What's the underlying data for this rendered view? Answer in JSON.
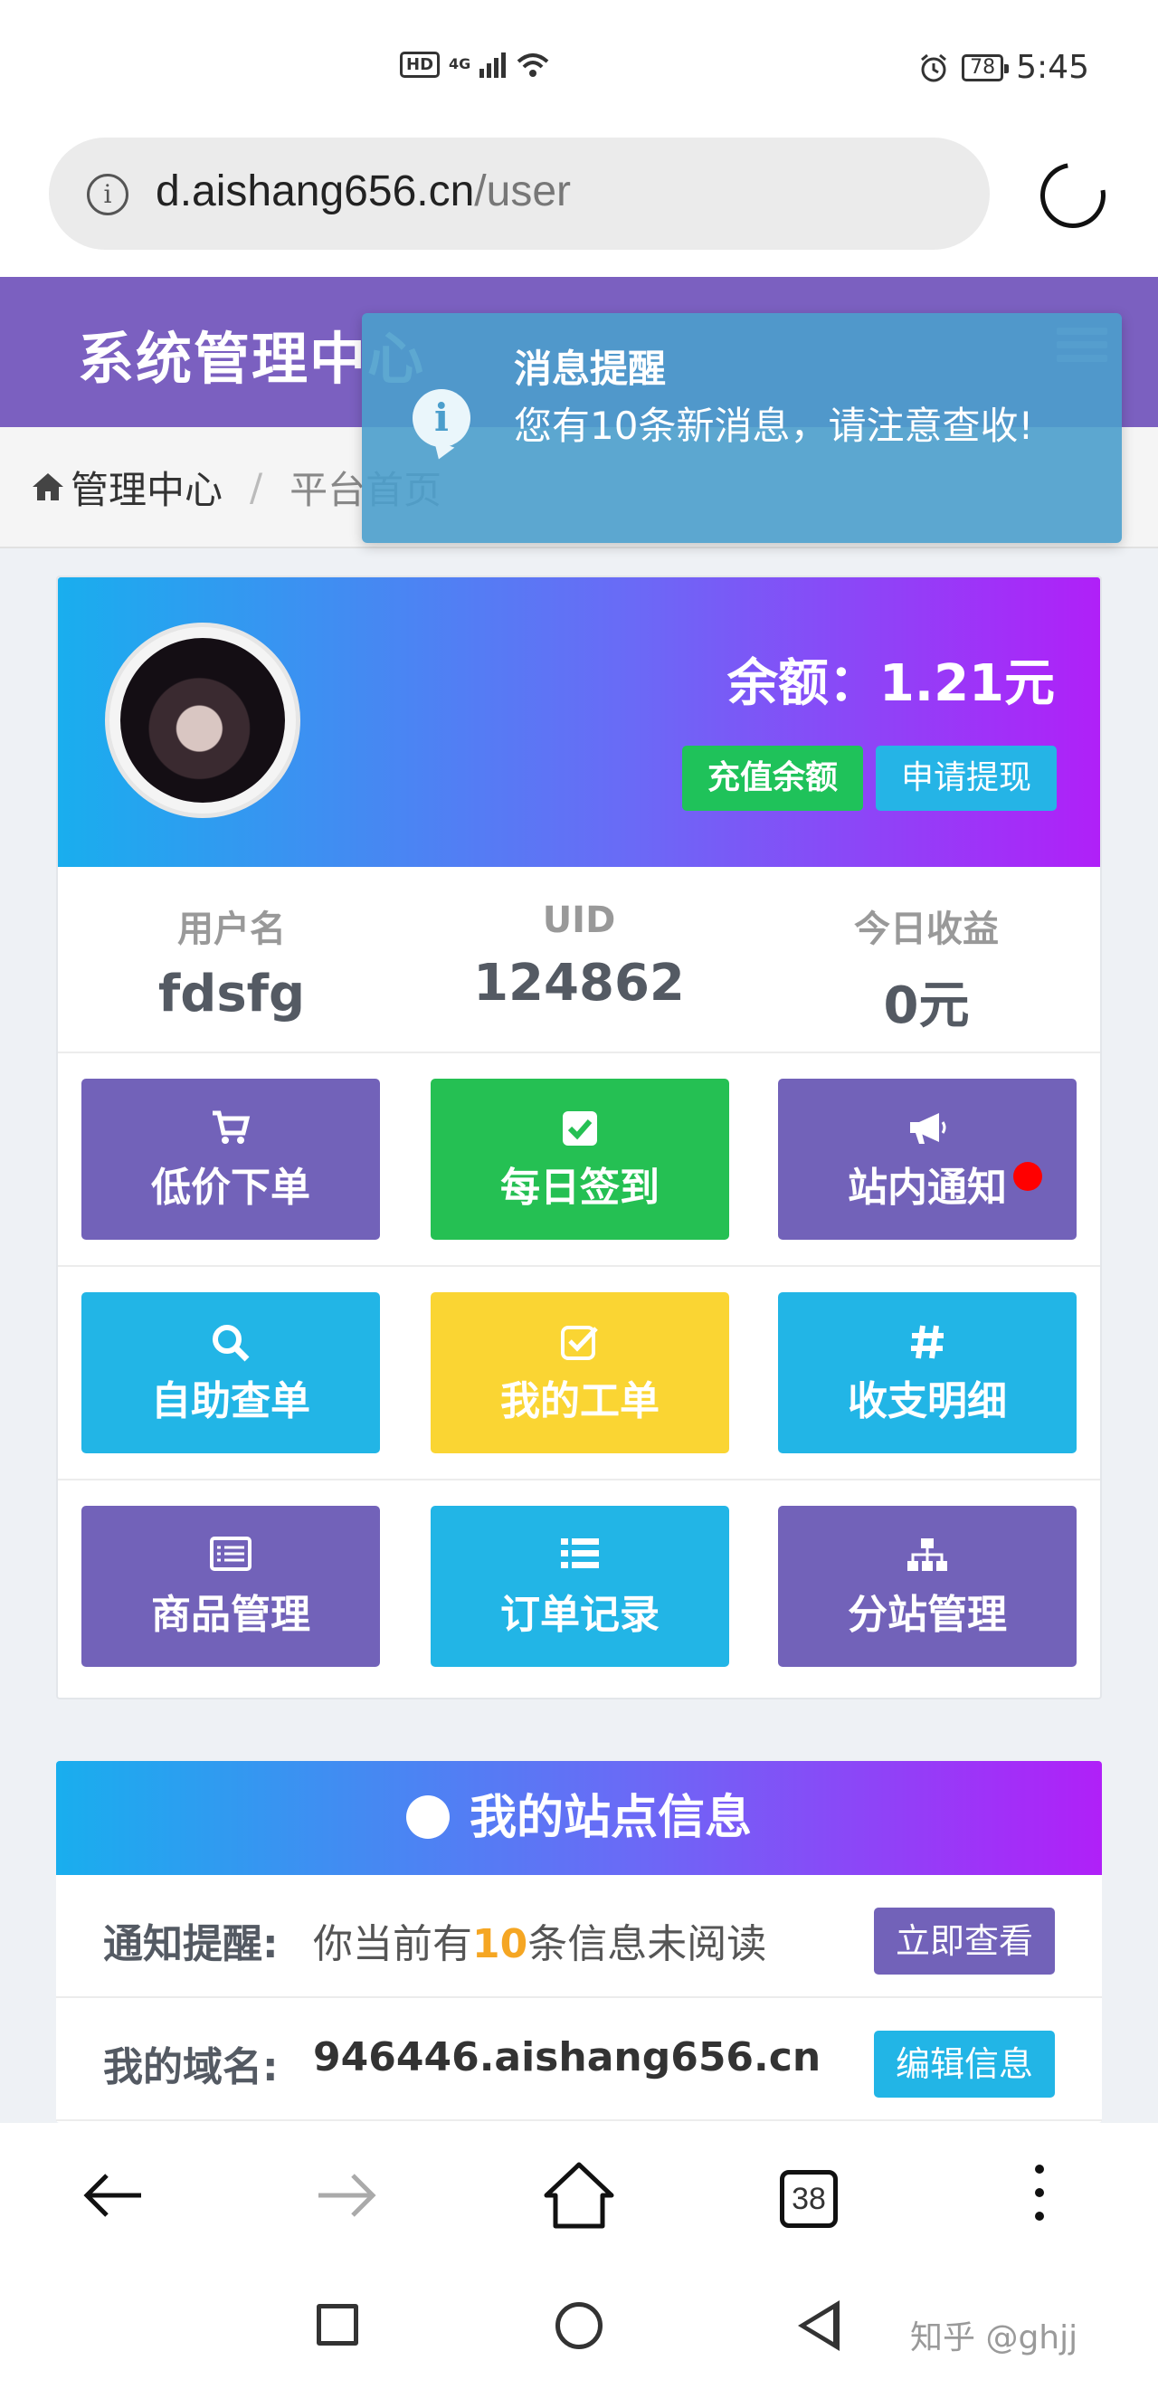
{
  "status_bar": {
    "hd": "HD",
    "network": "4G",
    "battery": "78",
    "time": "5:45"
  },
  "browser": {
    "url_host": "d.aishang656.cn",
    "url_path": "/user",
    "tab_count": "38"
  },
  "header": {
    "title": "系统管理中心"
  },
  "breadcrumb": {
    "home": "管理中心",
    "separator": "/",
    "current": "平台首页"
  },
  "toast": {
    "title": "消息提醒",
    "message": "您有10条新消息，请注意查收!"
  },
  "profile": {
    "balance": "余额：1.21元",
    "recharge_label": "充值余额",
    "withdraw_label": "申请提现",
    "stats": [
      {
        "label": "用户名",
        "value": "fdsfg"
      },
      {
        "label": "UID",
        "value": "124862"
      },
      {
        "label": "今日收益",
        "value": "0元"
      }
    ]
  },
  "tiles": [
    {
      "label": "低价下单",
      "icon": "cart-icon",
      "color": "#7262b9"
    },
    {
      "label": "每日签到",
      "icon": "check-square-icon",
      "color": "#25c053"
    },
    {
      "label": "站内通知",
      "icon": "megaphone-icon",
      "color": "#7262b9"
    },
    {
      "label": "自助查单",
      "icon": "search-icon",
      "color": "#22b5e6"
    },
    {
      "label": "我的工单",
      "icon": "check-square-o-icon",
      "color": "#fad533"
    },
    {
      "label": "收支明细",
      "icon": "hash-icon",
      "color": "#22b5e6"
    },
    {
      "label": "商品管理",
      "icon": "list-alt-icon",
      "color": "#7262b9"
    },
    {
      "label": "订单记录",
      "icon": "list-icon",
      "color": "#22b5e6"
    },
    {
      "label": "分站管理",
      "icon": "sitemap-icon",
      "color": "#7262b9"
    }
  ],
  "site_info": {
    "title": "我的站点信息",
    "notice_label": "通知提醒:",
    "notice_prefix": "你当前有",
    "notice_count": "10",
    "notice_suffix": "条信息未阅读",
    "notice_button": "立即查看",
    "domain_label": "我的域名:",
    "domain_value": "946446.aishang656.cn",
    "domain_button": "编辑信息"
  },
  "watermark": "知乎 @ghjj"
}
